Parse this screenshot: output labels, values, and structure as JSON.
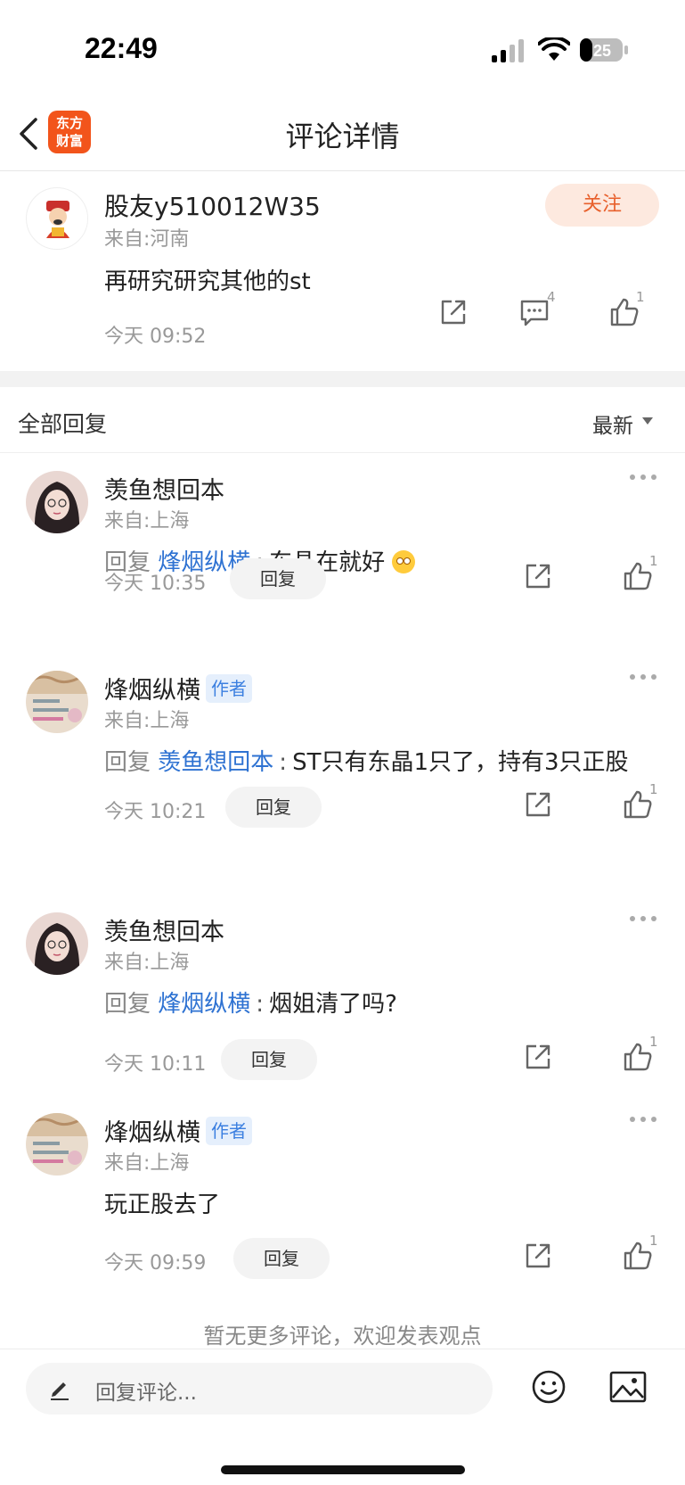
{
  "status_bar": {
    "time": "22:49",
    "battery": "25"
  },
  "nav": {
    "title": "评论详情",
    "logo_line1": "东方",
    "logo_line2": "财富"
  },
  "post": {
    "user": "股友y510012W35",
    "location": "来自:河南",
    "follow_label": "关注",
    "text": "再研究研究其他的st",
    "time": "今天 09:52",
    "comment_count": "4",
    "like_count": "1"
  },
  "replies_header": {
    "title": "全部回复",
    "sort_label": "最新"
  },
  "replies": [
    {
      "user": "羡鱼想回本",
      "location": "来自:上海",
      "prefix": "回复",
      "mention": "烽烟纵横",
      "colon": ":",
      "text": "东晶在就好",
      "time": "今天 10:35",
      "reply_label": "回复",
      "like_count": "1"
    },
    {
      "user": "烽烟纵横",
      "badge": "作者",
      "location": "来自:上海",
      "prefix": "回复",
      "mention": "羡鱼想回本",
      "colon": ":",
      "text": "ST只有东晶1只了，持有3只正股",
      "time": "今天 10:21",
      "reply_label": "回复",
      "like_count": "1"
    },
    {
      "user": "羡鱼想回本",
      "location": "来自:上海",
      "prefix": "回复",
      "mention": "烽烟纵横",
      "colon": ":",
      "text": "烟姐清了吗?",
      "time": "今天 10:11",
      "reply_label": "回复",
      "like_count": "1"
    },
    {
      "user": "烽烟纵横",
      "badge": "作者",
      "location": "来自:上海",
      "text": "玩正股去了",
      "time": "今天 09:59",
      "reply_label": "回复",
      "like_count": "1"
    }
  ],
  "no_more_text": "暂无更多评论，欢迎发表观点",
  "bottom_bar": {
    "placeholder": "回复评论..."
  },
  "colors": {
    "brand": "#f2541b",
    "mention": "#2e72d2",
    "follow_text": "#e8602c"
  }
}
